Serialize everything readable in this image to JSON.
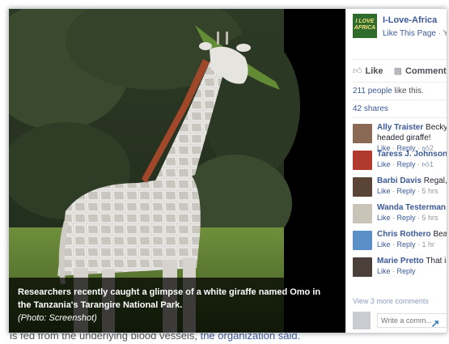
{
  "background_article": {
    "text_plain": "is fed from the underlying blood vessels,",
    "text_link": "the organization said."
  },
  "photo": {
    "caption": "Researchers recently caught a glimpse of a white giraffe named Omo in the Tanzania's Tarangire National Park.",
    "credit": "(Photo: Screenshot)"
  },
  "sidebar": {
    "page": {
      "logo_text_top": "I LOVE",
      "logo_text_bottom": "AFRICA",
      "name": "I-Love-Africa",
      "like_link": "Like This Page",
      "sub_sep": " · Y"
    },
    "actions": {
      "like": "Like",
      "comment": "Comment",
      "like_icon": "thumbs-up-icon",
      "comment_icon": "speech-bubble-icon"
    },
    "likes": {
      "link": "211 people",
      "rest": " like this."
    },
    "shares": "42 shares",
    "comments": [
      {
        "author": "Ally Traister",
        "text": " Becky",
        "line2": "headed giraffe!",
        "like": "Like",
        "reply": "Reply",
        "extra": "2",
        "color": "#8a6a55"
      },
      {
        "author": "Taress J. Johnson",
        "text": "",
        "line2": "",
        "like": "Like",
        "reply": "Reply",
        "extra": "1",
        "color": "#b03a2e"
      },
      {
        "author": "Barbi Davis",
        "text": " Regal,",
        "line2": "",
        "like": "Like",
        "reply": "Reply",
        "extra": "5 hrs",
        "color": "#5a4436"
      },
      {
        "author": "Wanda Testerman",
        "text": "",
        "line2": "",
        "like": "Like",
        "reply": "Reply",
        "extra": "5 hrs",
        "color": "#c9c3b8"
      },
      {
        "author": "Chris Rothero",
        "text": " Bea",
        "line2": "",
        "like": "Like",
        "reply": "Reply",
        "extra": "1 hr",
        "color": "#5b8fc7"
      },
      {
        "author": "Marie Pretto",
        "text": " That is",
        "line2": "",
        "like": "Like",
        "reply": "Reply",
        "extra": "",
        "color": "#4b3f3a"
      }
    ],
    "view_more": "View 3 more comments",
    "write_placeholder": "Write a comm..."
  },
  "expand_icon": "expand-arrow-icon"
}
